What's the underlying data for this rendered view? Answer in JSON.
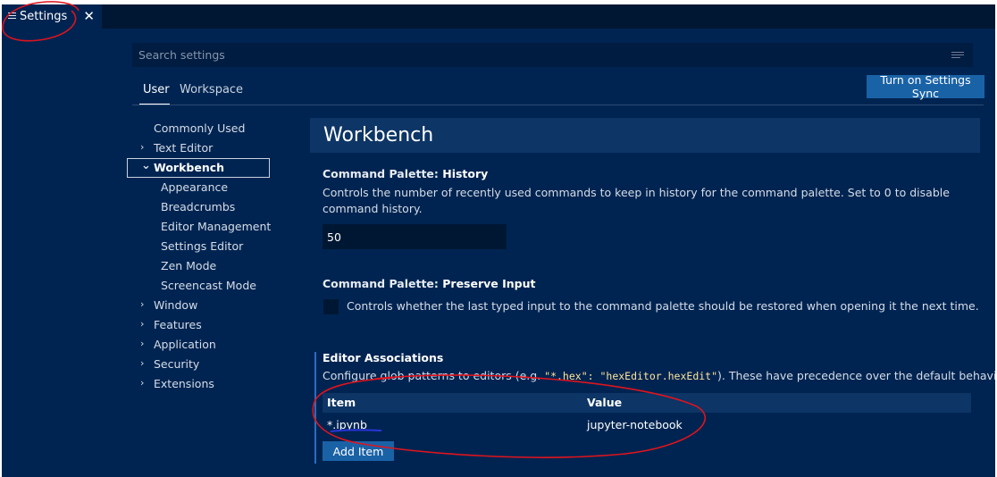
{
  "tab": {
    "title": "Settings",
    "close_glyph": "✕"
  },
  "search": {
    "placeholder": "Search settings"
  },
  "scope_tabs": [
    "User",
    "Workspace"
  ],
  "sync_button": "Turn on Settings Sync",
  "toc": [
    {
      "label": "Commonly Used",
      "chevron": ""
    },
    {
      "label": "Text Editor",
      "chevron": "›"
    },
    {
      "label": "Workbench",
      "chevron": "⌄",
      "selected": true
    },
    {
      "label": "Appearance",
      "chevron": ""
    },
    {
      "label": "Breadcrumbs",
      "chevron": ""
    },
    {
      "label": "Editor Management",
      "chevron": ""
    },
    {
      "label": "Settings Editor",
      "chevron": ""
    },
    {
      "label": "Zen Mode",
      "chevron": ""
    },
    {
      "label": "Screencast Mode",
      "chevron": ""
    },
    {
      "label": "Window",
      "chevron": "›"
    },
    {
      "label": "Features",
      "chevron": "›"
    },
    {
      "label": "Application",
      "chevron": "›"
    },
    {
      "label": "Security",
      "chevron": "›"
    },
    {
      "label": "Extensions",
      "chevron": "›"
    }
  ],
  "section_title": "Workbench",
  "settings": {
    "history": {
      "category": "Command Palette: ",
      "name": "History",
      "description": "Controls the number of recently used commands to keep in history for the command palette. Set to 0 to disable command history.",
      "value": "50"
    },
    "preserve_input": {
      "category": "Command Palette: ",
      "name": "Preserve Input",
      "description": "Controls whether the last typed input to the command palette should be restored when opening it the next time.",
      "checked": false
    },
    "editor_associations": {
      "name": "Editor Associations",
      "desc_prefix": "Configure glob patterns to editors (e.g. ",
      "code_sample": "\"*.hex\": \"hexEditor.hexEdit\"",
      "desc_suffix": "). These have precedence over the default behavior.",
      "columns": [
        "Item",
        "Value"
      ],
      "rows": [
        {
          "item": "*.ipynb",
          "value": "jupyter-notebook"
        }
      ],
      "add_button": "Add Item"
    }
  },
  "colors": {
    "background": "#002451",
    "tab_strip": "#001733",
    "button": "#1a62a6",
    "annotation_red": "#e0141e"
  },
  "icons": [
    "menu-icon",
    "close-icon",
    "filter-icon",
    "chevron-right-icon",
    "chevron-down-icon"
  ]
}
